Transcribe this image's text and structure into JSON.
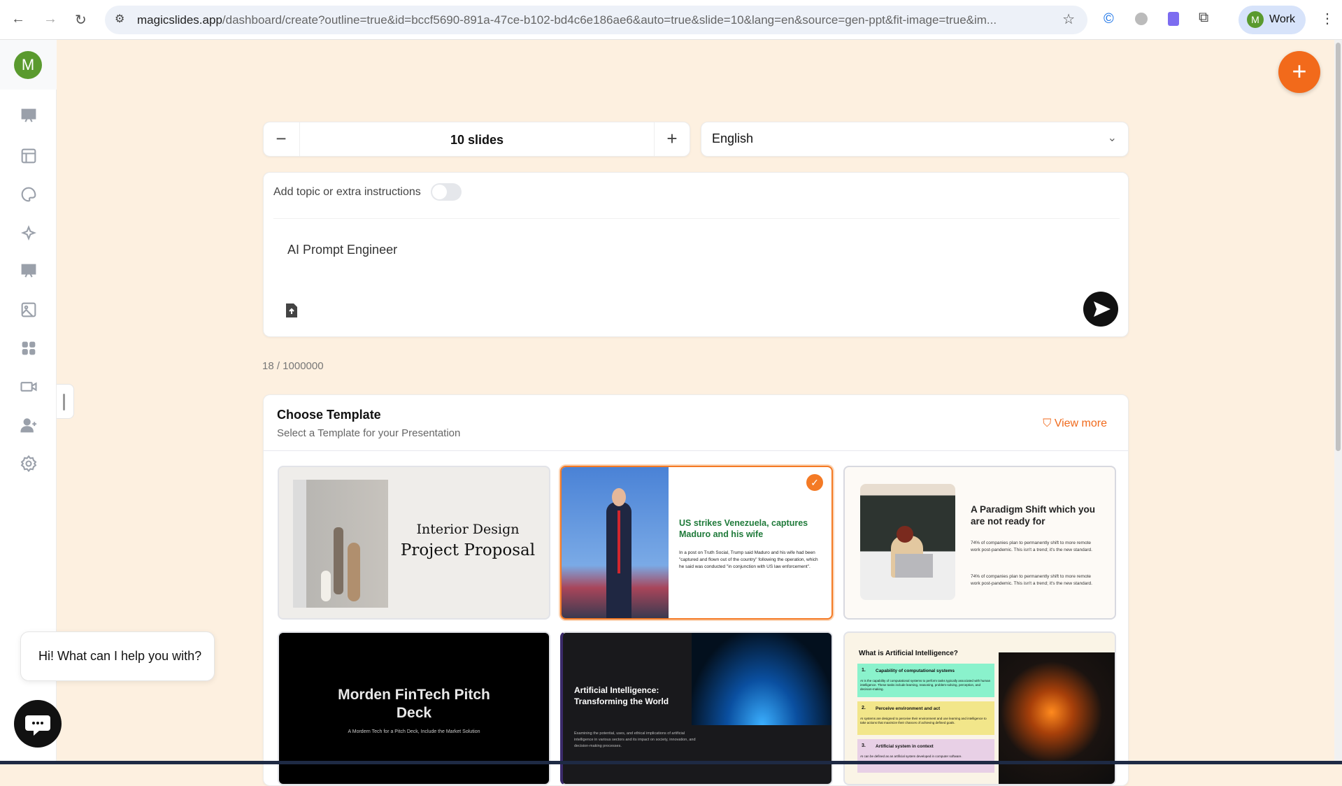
{
  "browser": {
    "url_host": "magicslides.app",
    "url_rest": "/dashboard/create?outline=true&id=bccf5690-891a-47ce-b102-bd4c6e186ae6&auto=true&slide=10&lang=en&source=gen-ppt&fit-image=true&im...",
    "profile_initial": "M",
    "profile_label": "Work"
  },
  "sidebar": {
    "avatar_initial": "M",
    "items": [
      "presentation",
      "templates",
      "themes",
      "ai-magic",
      "slides",
      "images",
      "apps",
      "video",
      "invite-user",
      "settings"
    ]
  },
  "controls": {
    "minus": "−",
    "slides_value": "10 slides",
    "plus": "+",
    "language": "English"
  },
  "prompt": {
    "toggle_label": "Add topic or extra instructions",
    "toggle_on": false,
    "text": "AI Prompt Engineer",
    "counter": "18 / 1000000"
  },
  "templates": {
    "title": "Choose Template",
    "subtitle": "Select a Template for your Presentation",
    "view_more": "View more",
    "items": [
      {
        "line1": "Interior Design",
        "line2": "Project Proposal",
        "selected": false
      },
      {
        "title": "US strikes Venezuela, captures Maduro and his wife",
        "body": "In a post on Truth Social, Trump said Maduro and his wife had been \"captured and flown out of the country\" following the operation, which he said was conducted \"in conjunction with US law enforcement\".",
        "selected": true
      },
      {
        "title": "A Paradigm Shift which you are not ready for",
        "body1": "74% of companies plan to permanently shift to more remote work post-pandemic. This isn't a trend; it's the new standard.",
        "body2": "74% of companies plan to permanently shift to more remote work post-pandemic. This isn't a trend; it's the new standard.",
        "selected": false
      },
      {
        "title": "Morden FinTech Pitch Deck",
        "sub": "A Mordern Tech for a Pitch Deck, Include the Market Solution"
      },
      {
        "title": "Artificial Intelligence: Transforming the World",
        "body": "Examining the potential, uses, and ethical implications of artificial intelligence in various sectors and its impact on society, innovation, and decision-making processes."
      },
      {
        "title": "What is Artificial Intelligence?",
        "points": [
          {
            "n": "1.",
            "h": "Capability of computational systems",
            "t": "AI is the capability of computational systems to perform tasks typically associated with human intelligence. These tasks include learning, reasoning, problem-solving, perception, and decision-making."
          },
          {
            "n": "2.",
            "h": "Perceive environment and act",
            "t": "AI systems are designed to perceive their environment and use learning and intelligence to take actions that maximize their chances of achieving defined goals."
          },
          {
            "n": "3.",
            "h": "Artificial system in context",
            "t": "AI can be defined as an artificial system developed in computer software."
          }
        ]
      }
    ]
  },
  "chat": {
    "greeting": "Hi! What can I help you with?"
  },
  "fab": "+",
  "colors": {
    "accent": "#f26a1b",
    "bg": "#fdf0e0",
    "green_title": "#1f7a3a"
  }
}
